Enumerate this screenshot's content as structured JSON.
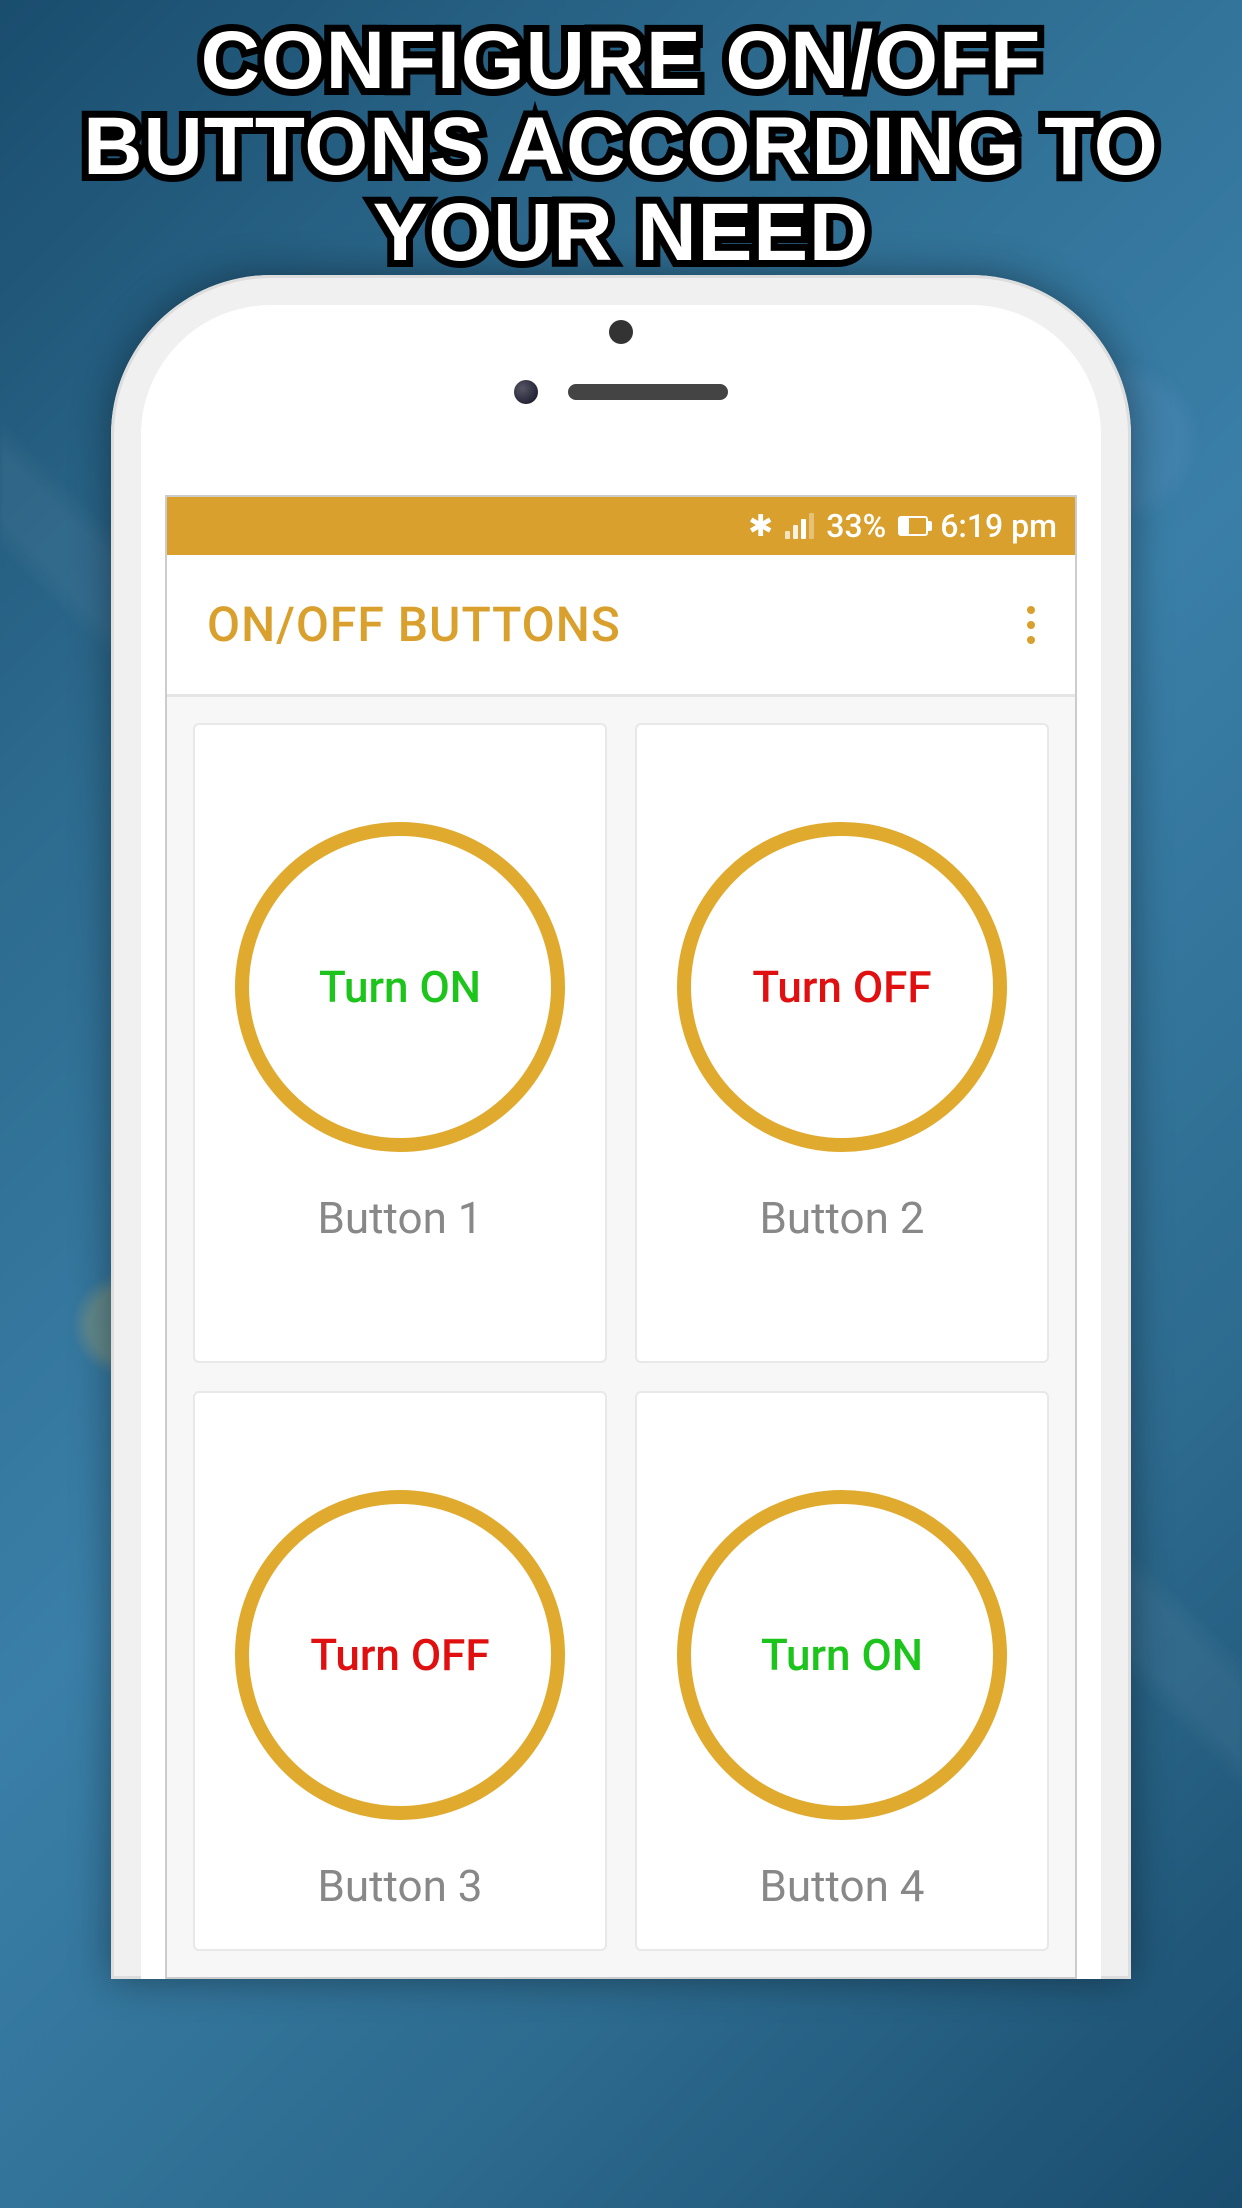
{
  "promo": {
    "headline": "CONFIGURE ON/OFF BUTTONS ACCORDING TO YOUR NEED"
  },
  "status_bar": {
    "bluetooth": "bluetooth",
    "battery_pct": "33%",
    "time": "6:19 pm"
  },
  "app_bar": {
    "title": "ON/OFF BUTTONS"
  },
  "buttons": [
    {
      "state": "on",
      "action_label": "Turn ON",
      "name": "Button 1"
    },
    {
      "state": "off",
      "action_label": "Turn OFF",
      "name": "Button 2"
    },
    {
      "state": "off",
      "action_label": "Turn OFF",
      "name": "Button 3"
    },
    {
      "state": "on",
      "action_label": "Turn ON",
      "name": "Button 4"
    }
  ],
  "colors": {
    "accent": "#d9a02e",
    "on_text": "#1cc41c",
    "off_text": "#e01010"
  }
}
